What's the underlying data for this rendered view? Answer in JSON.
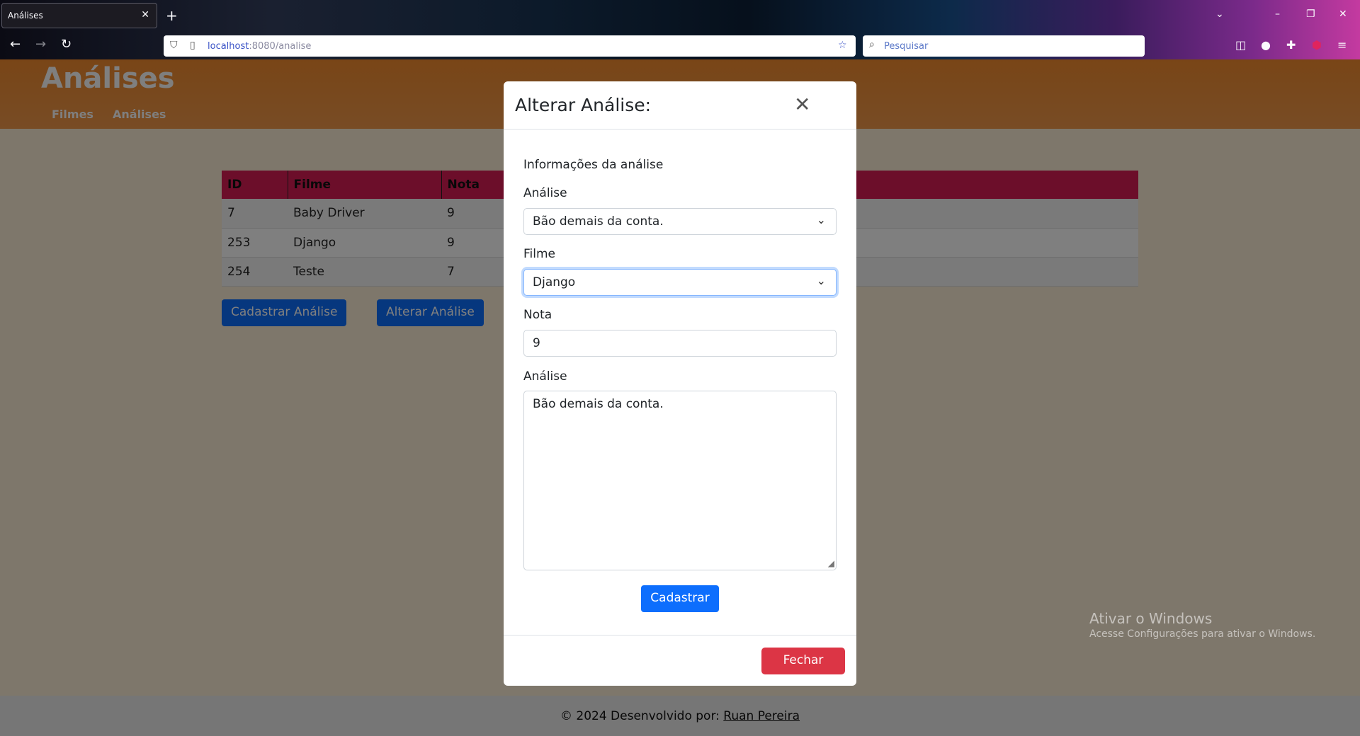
{
  "browser": {
    "tab_title": "Análises",
    "url_host": "localhost",
    "url_rest": ":8080/analise",
    "search_placeholder": "Pesquisar"
  },
  "page": {
    "site_title": "Análises",
    "nav": [
      "Filmes",
      "Análises"
    ],
    "table": {
      "headers": [
        "ID",
        "Filme",
        "Nota"
      ],
      "rows": [
        [
          "7",
          "Baby Driver",
          "9"
        ],
        [
          "253",
          "Django",
          "9"
        ],
        [
          "254",
          "Teste",
          "7"
        ]
      ]
    },
    "buttons": {
      "register": "Cadastrar Análise",
      "alter": "Alterar Análise"
    },
    "footer": {
      "text": "© 2024 Desenvolvido por: ",
      "author": "Ruan Pereira"
    },
    "watermark": {
      "line1": "Ativar o Windows",
      "line2": "Acesse Configurações para ativar o Windows."
    }
  },
  "modal": {
    "title": "Alterar Análise:",
    "section": "Informações da análise",
    "analise_label": "Análise",
    "analise_select": "Bão demais da conta.",
    "filme_label": "Filme",
    "filme_select": "Django",
    "nota_label": "Nota",
    "nota_value": "9",
    "texto_label": "Análise",
    "texto_value": "Bão demais da conta.",
    "submit": "Cadastrar",
    "close": "Fechar"
  },
  "colors": {
    "header": "#f28b2e",
    "table_header": "#d81c55",
    "primary": "#0d6efd",
    "danger": "#dc3545"
  }
}
